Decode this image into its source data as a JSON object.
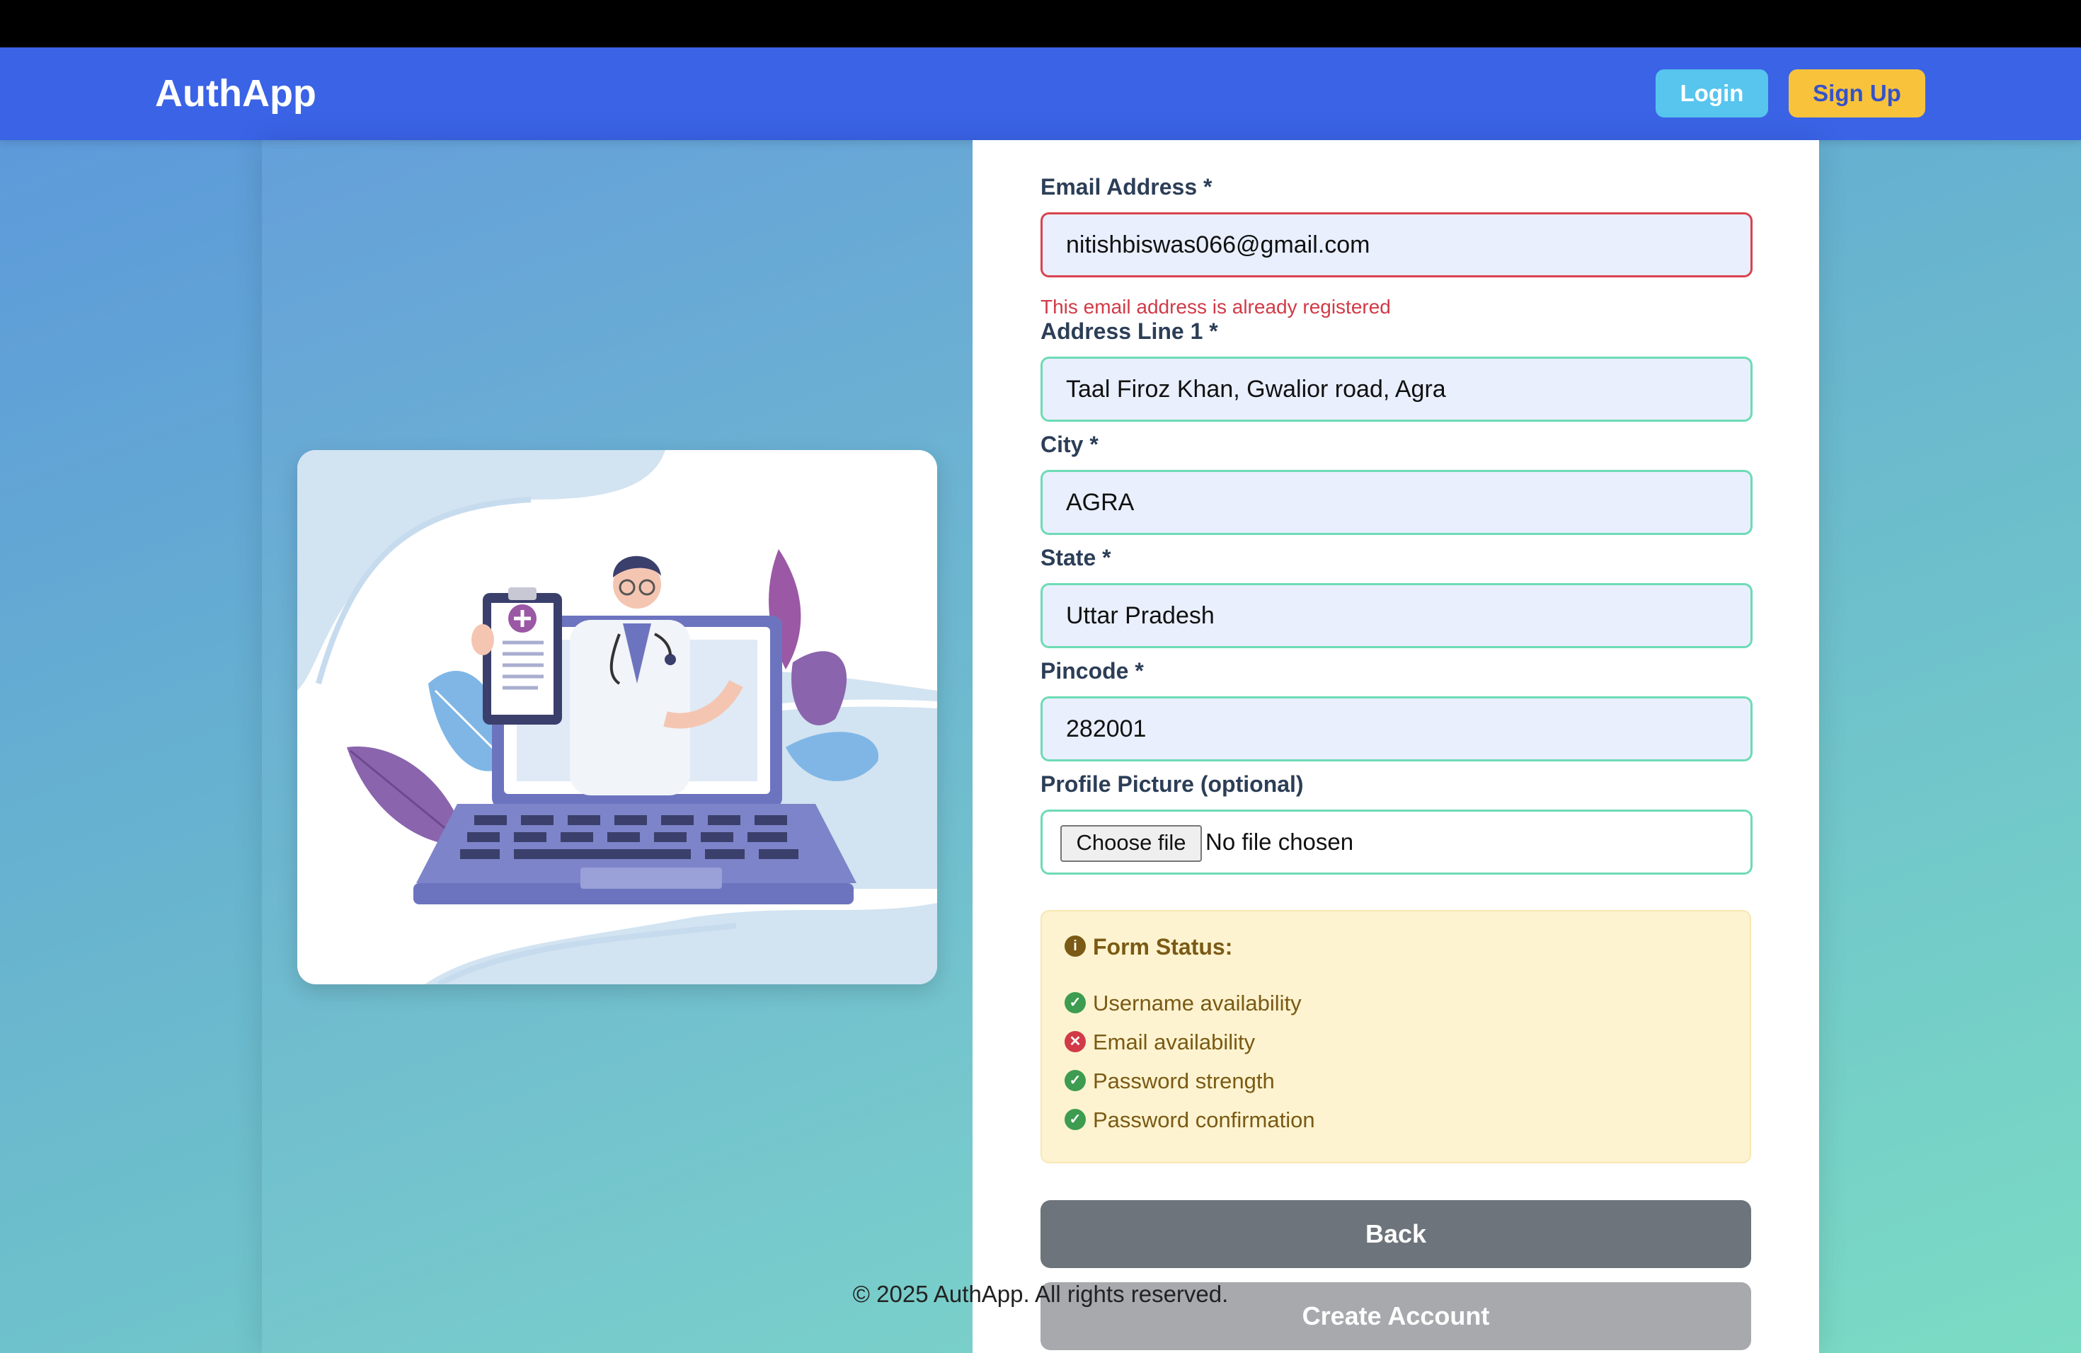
{
  "navbar": {
    "brand": "AuthApp",
    "login_label": "Login",
    "signup_label": "Sign Up"
  },
  "form": {
    "email": {
      "label": "Email Address *",
      "value": "nitishbiswas066@gmail.com",
      "error": "This email address is already registered"
    },
    "address": {
      "label": "Address Line 1 *",
      "value": "Taal Firoz Khan, Gwalior road, Agra"
    },
    "city": {
      "label": "City *",
      "value": "AGRA"
    },
    "state": {
      "label": "State *",
      "value": "Uttar Pradesh"
    },
    "pincode": {
      "label": "Pincode *",
      "value": "282001"
    },
    "profile_picture": {
      "label": "Profile Picture (optional)",
      "button_label": "Choose file",
      "status_text": "No file chosen"
    }
  },
  "form_status": {
    "title": "Form Status:",
    "items": [
      {
        "label": "Username availability",
        "state": "ok"
      },
      {
        "label": "Email availability",
        "state": "error"
      },
      {
        "label": "Password strength",
        "state": "ok"
      },
      {
        "label": "Password confirmation",
        "state": "ok"
      }
    ]
  },
  "actions": {
    "back_label": "Back",
    "create_label": "Create Account"
  },
  "footer": {
    "text": "© 2025 AuthApp. All rights reserved."
  },
  "colors": {
    "navbar": "#3a63e6",
    "login": "#57c5ee",
    "signup": "#f8c33b",
    "error": "#d13a46",
    "valid_border": "#6ddbb5",
    "success": "#3d9c4f"
  }
}
